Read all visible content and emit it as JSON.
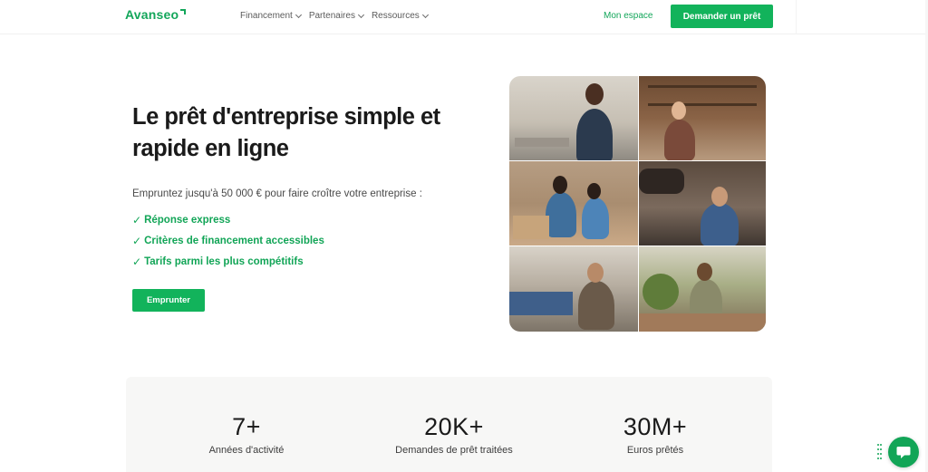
{
  "header": {
    "logo": "Avanseo",
    "nav": [
      {
        "label": "Financement"
      },
      {
        "label": "Partenaires"
      },
      {
        "label": "Ressources"
      }
    ],
    "account_link": "Mon espace",
    "cta_button": "Demander un prêt"
  },
  "hero": {
    "title": "Le prêt d'entreprise simple et rapide en ligne",
    "subtitle": "Empruntez jusqu'à 50 000 € pour faire croître votre entreprise :",
    "checks": [
      "Réponse express",
      "Critères de financement accessibles",
      "Tarifs parmi les plus compétitifs"
    ],
    "check_symbol": "✓",
    "button": "Emprunter"
  },
  "stats": [
    {
      "value": "7+",
      "label": "Années d'activité"
    },
    {
      "value": "20K+",
      "label": "Demandes de prêt traitées"
    },
    {
      "value": "30M+",
      "label": "Euros prêtés"
    }
  ],
  "colors": {
    "brand_green": "#12b35b",
    "text_dark": "#1a1a1a"
  },
  "icons": {
    "chat": "chat-bubble-icon",
    "nav_dropdown": "chevron-down-icon"
  }
}
